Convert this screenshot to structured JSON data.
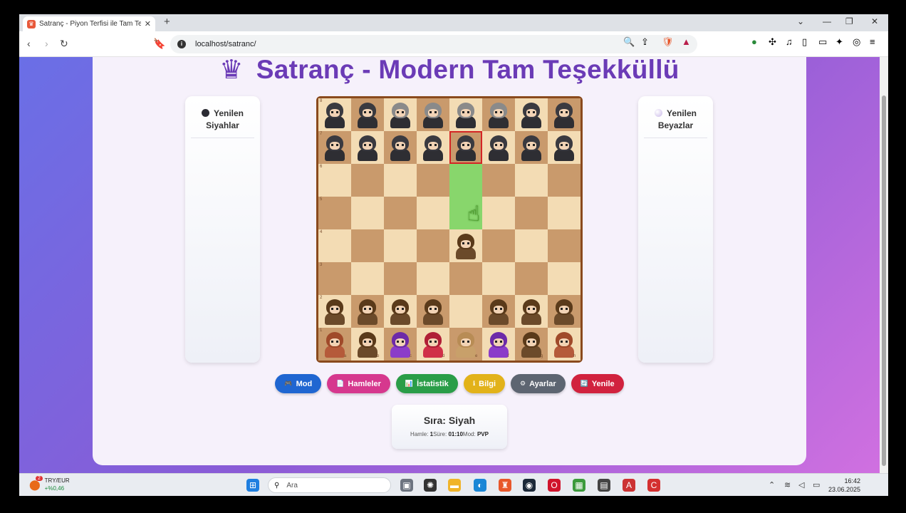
{
  "browser": {
    "tab_title": "Satranç - Piyon Terfisi ile Tam Teş",
    "tab_close": "✕",
    "new_tab": "+",
    "url": "localhost/satranc/"
  },
  "page": {
    "title": "Satranç - Modern Tam Teşekküllü",
    "left_panel": {
      "line1": "Yenilen",
      "line2": "Siyahlar"
    },
    "right_panel": {
      "line1": "Yenilen",
      "line2": "Beyazlar"
    },
    "board": {
      "ranks": [
        "8",
        "7",
        "6",
        "5",
        "4",
        "3",
        "2",
        "1"
      ],
      "files": [
        "a",
        "b",
        "c",
        "d",
        "e",
        "f",
        "g",
        "h"
      ],
      "selected_square": "e7",
      "highlighted_squares": [
        "e6",
        "e5"
      ],
      "black_pieces": [
        "a8",
        "b8",
        "c8",
        "d8",
        "e8",
        "f8",
        "g8",
        "h8",
        "a7",
        "b7",
        "c7",
        "d7",
        "e7",
        "f7",
        "g7",
        "h7"
      ],
      "white_pieces": [
        "a1",
        "b1",
        "c1",
        "d1",
        "e1",
        "f1",
        "g1",
        "h1",
        "a2",
        "b2",
        "c2",
        "d2",
        "f2",
        "g2",
        "h2",
        "e4"
      ]
    },
    "buttons": [
      {
        "label": "Mod",
        "icon": "🎮",
        "color": "#1f66d1"
      },
      {
        "label": "Hamleler",
        "icon": "📄",
        "color": "#d6388e"
      },
      {
        "label": "İstatistik",
        "icon": "📊",
        "color": "#2a9d48"
      },
      {
        "label": "Bilgi",
        "icon": "ℹ",
        "color": "#e2b21a"
      },
      {
        "label": "Ayarlar",
        "icon": "⚙",
        "color": "#5d6571"
      },
      {
        "label": "Yenile",
        "icon": "🔄",
        "color": "#d1223e"
      }
    ],
    "status": {
      "turn": "Sıra: Siyah",
      "moves_label": "Hamle:",
      "moves_value": "1",
      "time_label": "Süre:",
      "time_value": "01:10",
      "mode_label": "Mod:",
      "mode_value": "PVP"
    }
  },
  "taskbar": {
    "weather_label": "TRY/EUR",
    "weather_change": "+%0,46",
    "weather_badge": "2",
    "search_placeholder": "Ara",
    "time": "16:42",
    "date": "23.06.2025"
  }
}
